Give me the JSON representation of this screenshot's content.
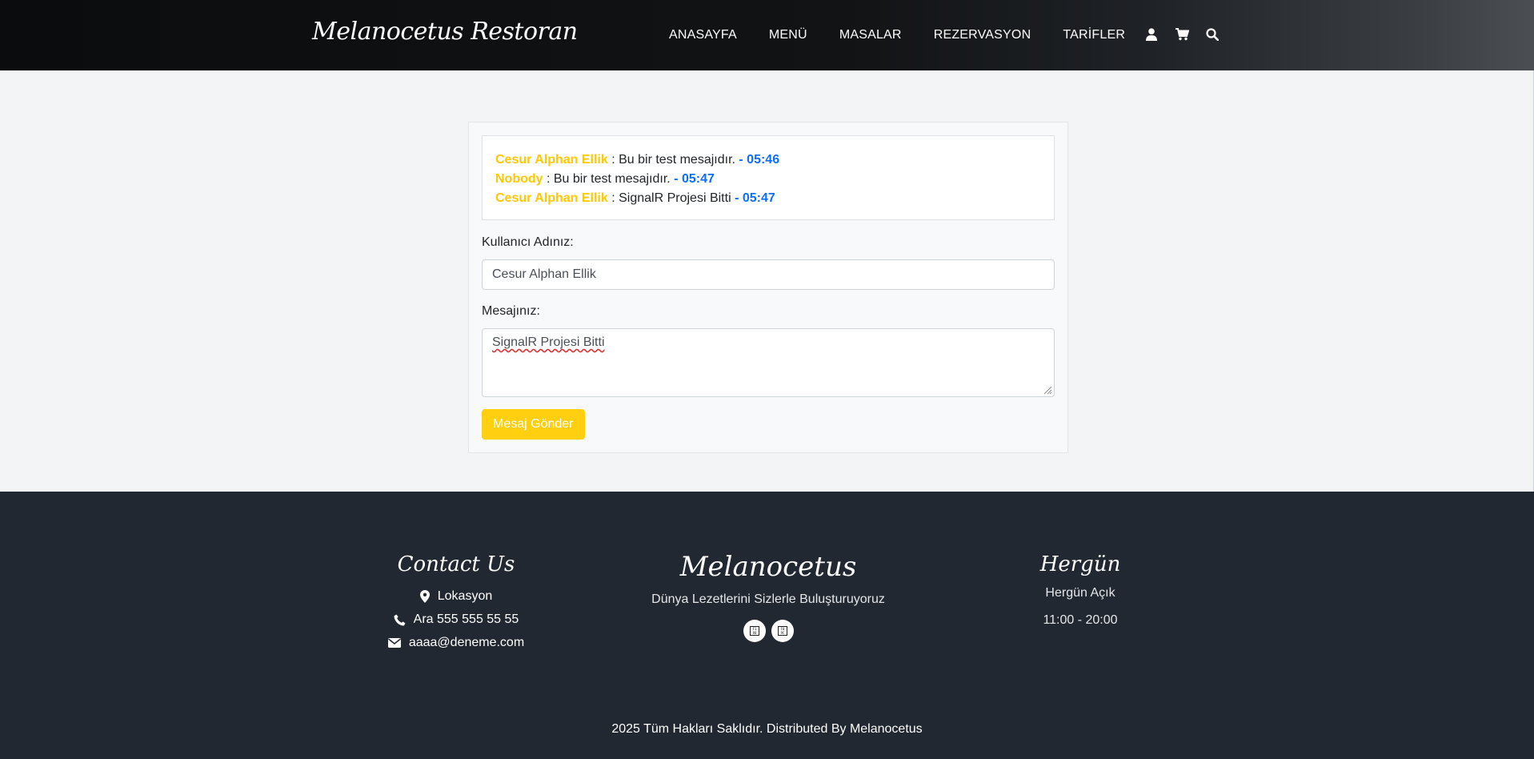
{
  "header": {
    "brand": "Melanocetus Restoran",
    "nav": [
      "ANASAYFA",
      "MENÜ",
      "MASALAR",
      "REZERVASYON",
      "TARİFLER"
    ],
    "icons": [
      "user-icon",
      "cart-icon",
      "search-icon"
    ]
  },
  "chat": {
    "messages": [
      {
        "user": "Cesur Alphan Ellik",
        "text": " : Bu bir test mesajıdır. ",
        "time": "- 05:46"
      },
      {
        "user": "Nobody",
        "text": " : Bu bir test mesajıdır. ",
        "time": "- 05:47"
      },
      {
        "user": "Cesur Alphan Ellik",
        "text": " : SignalR Projesi Bitti ",
        "time": "- 05:47"
      }
    ],
    "username_label": "Kullanıcı Adınız:",
    "username_value": "Cesur Alphan Ellik",
    "message_label": "Mesajınız:",
    "message_value": "SignalR Projesi Bitti",
    "send_label": "Mesaj Gönder"
  },
  "footer": {
    "contact_title": "Contact Us",
    "location": "Lokasyon",
    "phone": "Ara 555 555 55 55",
    "email": "aaaa@deneme.com",
    "brand": "Melanocetus",
    "tagline": "Dünya Lezetlerini Sizlerle Buluşturuyoruz",
    "social_icons": [
      "facebook-icon",
      "twitter-icon"
    ],
    "hours_title": "Hergün",
    "hours_days": "Hergün Açık",
    "hours_time": "11:00 - 20:00",
    "copyright": "2025 Tüm Hakları Saklıdır. Distributed By Melanocetus"
  },
  "colors": {
    "accent": "#ffcf10",
    "user_name": "#ffc800",
    "timestamp": "#0d6efd",
    "footer_bg": "#222831"
  }
}
